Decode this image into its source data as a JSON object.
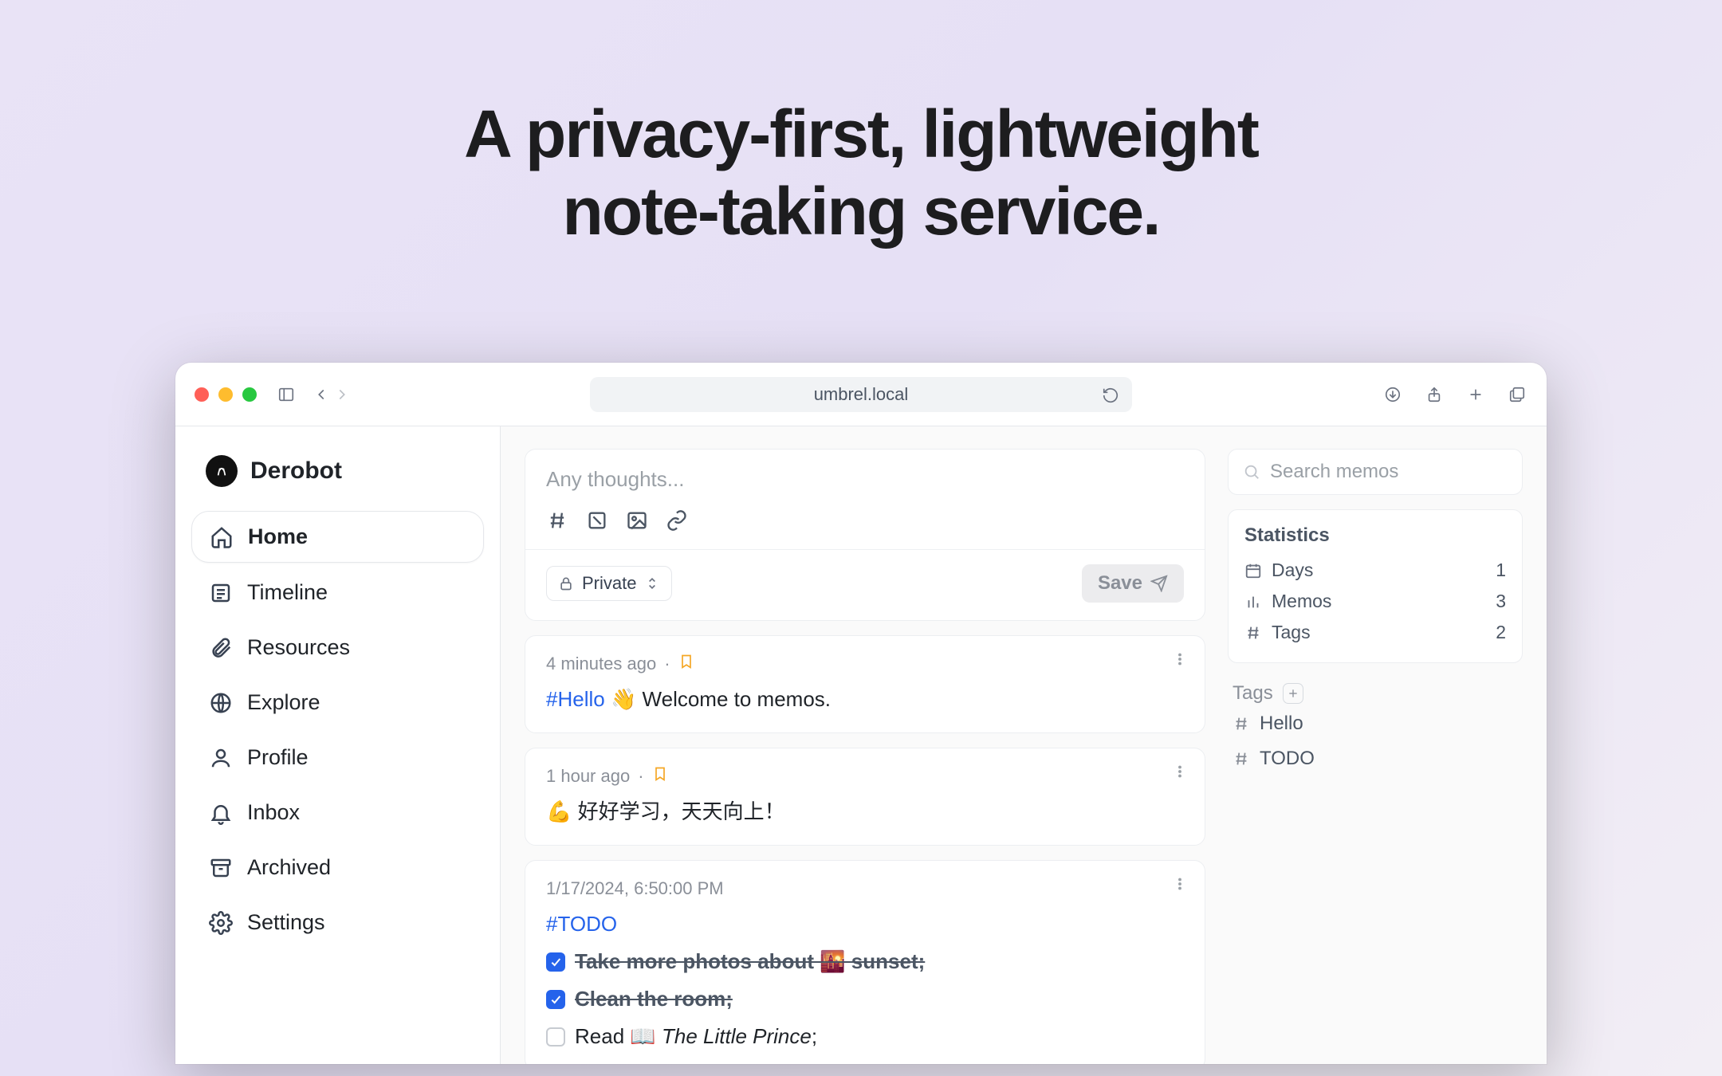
{
  "hero": {
    "line1": "A privacy-first, lightweight",
    "line2": "note-taking service."
  },
  "browser": {
    "url": "umbrel.local"
  },
  "sidebar": {
    "username": "Derobot",
    "items": [
      {
        "label": "Home"
      },
      {
        "label": "Timeline"
      },
      {
        "label": "Resources"
      },
      {
        "label": "Explore"
      },
      {
        "label": "Profile"
      },
      {
        "label": "Inbox"
      },
      {
        "label": "Archived"
      },
      {
        "label": "Settings"
      }
    ]
  },
  "composer": {
    "placeholder": "Any thoughts...",
    "visibility": "Private",
    "save_label": "Save"
  },
  "memos": [
    {
      "time": "4 minutes ago",
      "bookmarked": true,
      "prefix": "#Hello",
      "body": " 👋 Welcome to memos."
    },
    {
      "time": "1 hour ago",
      "bookmarked": true,
      "body": "💪 好好学习，天天向上！"
    },
    {
      "time": "1/17/2024, 6:50:00 PM",
      "hashtag": "#TODO",
      "todos": [
        {
          "done": true,
          "text": "Take more photos about 🌇 sunset;"
        },
        {
          "done": true,
          "text": "Clean the room;"
        },
        {
          "done": false,
          "text_prefix": "Read 📖 ",
          "text_italic": "The Little Prince",
          "text_suffix": ";"
        }
      ]
    }
  ],
  "search": {
    "placeholder": "Search memos"
  },
  "stats": {
    "title": "Statistics",
    "rows": [
      {
        "label": "Days",
        "value": "1"
      },
      {
        "label": "Memos",
        "value": "3"
      },
      {
        "label": "Tags",
        "value": "2"
      }
    ]
  },
  "tags": {
    "title": "Tags",
    "items": [
      {
        "label": "Hello"
      },
      {
        "label": "TODO"
      }
    ]
  }
}
